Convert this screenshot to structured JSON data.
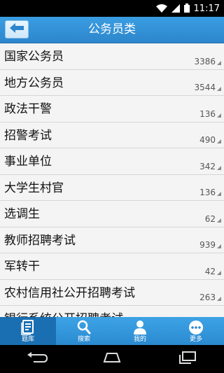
{
  "status": {
    "time": "11:17"
  },
  "header": {
    "title": "公务员类"
  },
  "categories": [
    {
      "name": "国家公务员",
      "count": "3386"
    },
    {
      "name": "地方公务员",
      "count": "3544"
    },
    {
      "name": "政法干警",
      "count": "136"
    },
    {
      "name": "招警考试",
      "count": "490"
    },
    {
      "name": "事业单位",
      "count": "342"
    },
    {
      "name": "大学生村官",
      "count": "136"
    },
    {
      "name": "选调生",
      "count": "62"
    },
    {
      "name": "教师招聘考试",
      "count": "939"
    },
    {
      "name": "军转干",
      "count": "42"
    },
    {
      "name": "农村信用社公开招聘考试",
      "count": "263"
    },
    {
      "name": "银行系统公开招聘考试",
      "count": ""
    }
  ],
  "tabs": [
    {
      "label": "题库",
      "icon": "question-bank-icon",
      "active": true
    },
    {
      "label": "搜索",
      "icon": "search-icon",
      "active": false
    },
    {
      "label": "我的",
      "icon": "user-icon",
      "active": false
    },
    {
      "label": "更多",
      "icon": "more-icon",
      "active": false
    }
  ],
  "colors": {
    "header": "#2d86cc",
    "tab_bar": "#2b8ad0",
    "tab_active": "#1a6fb3"
  }
}
